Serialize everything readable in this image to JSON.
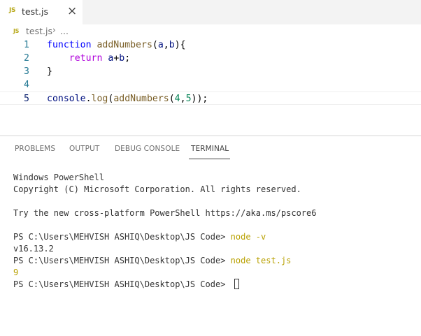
{
  "tab": {
    "icon": "JS",
    "title": "test.js",
    "close": "×"
  },
  "breadcrumb": {
    "icon": "JS",
    "file": "test.js",
    "separator": "›",
    "more": "..."
  },
  "editor": {
    "lines": [
      {
        "num": "1",
        "tokens": [
          [
            "function",
            "kw"
          ],
          [
            " ",
            ""
          ],
          [
            "addNumbers",
            "fn"
          ],
          [
            "(",
            ""
          ],
          [
            "a",
            "pr"
          ],
          [
            ",",
            ""
          ],
          [
            "b",
            "pr"
          ],
          [
            "){",
            ""
          ]
        ]
      },
      {
        "num": "2",
        "tokens": [
          [
            "    ",
            ""
          ],
          [
            "return",
            "kw2"
          ],
          [
            " ",
            ""
          ],
          [
            "a",
            "pr"
          ],
          [
            "+",
            ""
          ],
          [
            "b",
            "pr"
          ],
          [
            ";",
            ""
          ]
        ]
      },
      {
        "num": "3",
        "tokens": [
          [
            "}",
            ""
          ]
        ]
      },
      {
        "num": "4",
        "tokens": []
      },
      {
        "num": "5",
        "tokens": [
          [
            "console",
            "pr"
          ],
          [
            ".",
            ""
          ],
          [
            "log",
            "fn"
          ],
          [
            "(",
            ""
          ],
          [
            "addNumbers",
            "fn"
          ],
          [
            "(",
            ""
          ],
          [
            "4",
            "num"
          ],
          [
            ",",
            ""
          ],
          [
            "5",
            "num"
          ],
          [
            "));",
            ""
          ]
        ]
      }
    ]
  },
  "panel": {
    "tabs": [
      "PROBLEMS",
      "OUTPUT",
      "DEBUG CONSOLE",
      "TERMINAL"
    ],
    "active_tab": "TERMINAL"
  },
  "terminal": {
    "line1": "Windows PowerShell",
    "line2": "Copyright (C) Microsoft Corporation. All rights reserved.",
    "line3": "Try the new cross-platform PowerShell https://aka.ms/pscore6",
    "prompt": "PS C:\\Users\\MEHVISH ASHIQ\\Desktop\\JS Code> ",
    "cmd1": "node -v",
    "out1": "v16.13.2",
    "cmd2": "node test.js",
    "out2": "9"
  },
  "colors": {
    "accent_js": "#b8a91a",
    "line_number": "#237893",
    "keyword": "#0000ff",
    "function": "#795e26"
  }
}
